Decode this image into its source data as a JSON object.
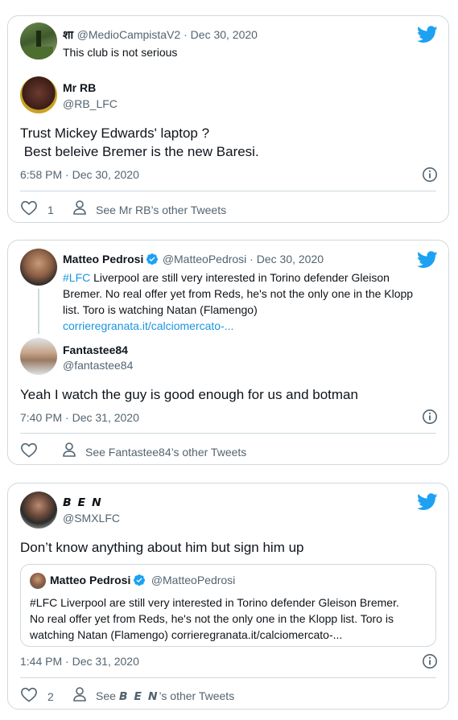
{
  "cards": [
    {
      "parent": {
        "name": "शा",
        "handle": "@MedioCampistaV2",
        "date": "Dec 30, 2020",
        "text": "This club is not serious"
      },
      "author": {
        "name": "Mr RB",
        "handle": "@RB_LFC"
      },
      "text_line1": "Trust Mickey Edwards' laptop ?",
      "text_line2": " Best beleive Bremer is the new Baresi.",
      "timestamp": "6:58 PM · Dec 30, 2020",
      "likes": "1",
      "other_tweets": "See Mr RB’s other Tweets"
    },
    {
      "parent": {
        "name": "Matteo Pedrosi",
        "handle": "@MatteoPedrosi",
        "date": "Dec 30, 2020",
        "hashtag": "#LFC",
        "text_rest": " Liverpool are still very interested in Torino defender Gleison",
        "line2": "Bremer. No real offer yet from Reds, he's not the only one in the Klopp",
        "line3": "list. Toro is watching Natan (Flamengo)",
        "link": "corrieregranata.it/calciomercato-..."
      },
      "author": {
        "name": "Fantastee84",
        "handle": "@fantastee84"
      },
      "text": "Yeah I watch the guy is good enough for us and botman",
      "timestamp": "7:40 PM · Dec 31, 2020",
      "likes": "",
      "other_tweets": "See Fantastee84’s other Tweets"
    },
    {
      "author": {
        "name": "𝘽 𝙀 𝙉",
        "handle": "@SMXLFC"
      },
      "text": "Don’t know anything about him but sign him up",
      "quote": {
        "name": "Matteo Pedrosi",
        "handle": "@MatteoPedrosi",
        "line1": "#LFC Liverpool are still very interested in Torino defender Gleison Bremer.",
        "line2": "No real offer yet from Reds, he's not the only one in the Klopp list. Toro is",
        "line3": "watching Natan (Flamengo) corrieregranata.it/calciomercato-..."
      },
      "timestamp": "1:44 PM · Dec 31, 2020",
      "likes": "2",
      "other_tweets_prefix": "See ",
      "other_tweets_name": "𝘽 𝙀 𝙉",
      "other_tweets_suffix": "’s other Tweets"
    }
  ],
  "separator": " · ",
  "colors": {
    "accent": "#1da1f2",
    "link": "#1b95e0",
    "muted": "#536471",
    "border": "#cfd9de"
  },
  "icons": [
    "twitter-bird-icon",
    "heart-icon",
    "person-icon",
    "info-icon",
    "verified-badge-icon"
  ]
}
